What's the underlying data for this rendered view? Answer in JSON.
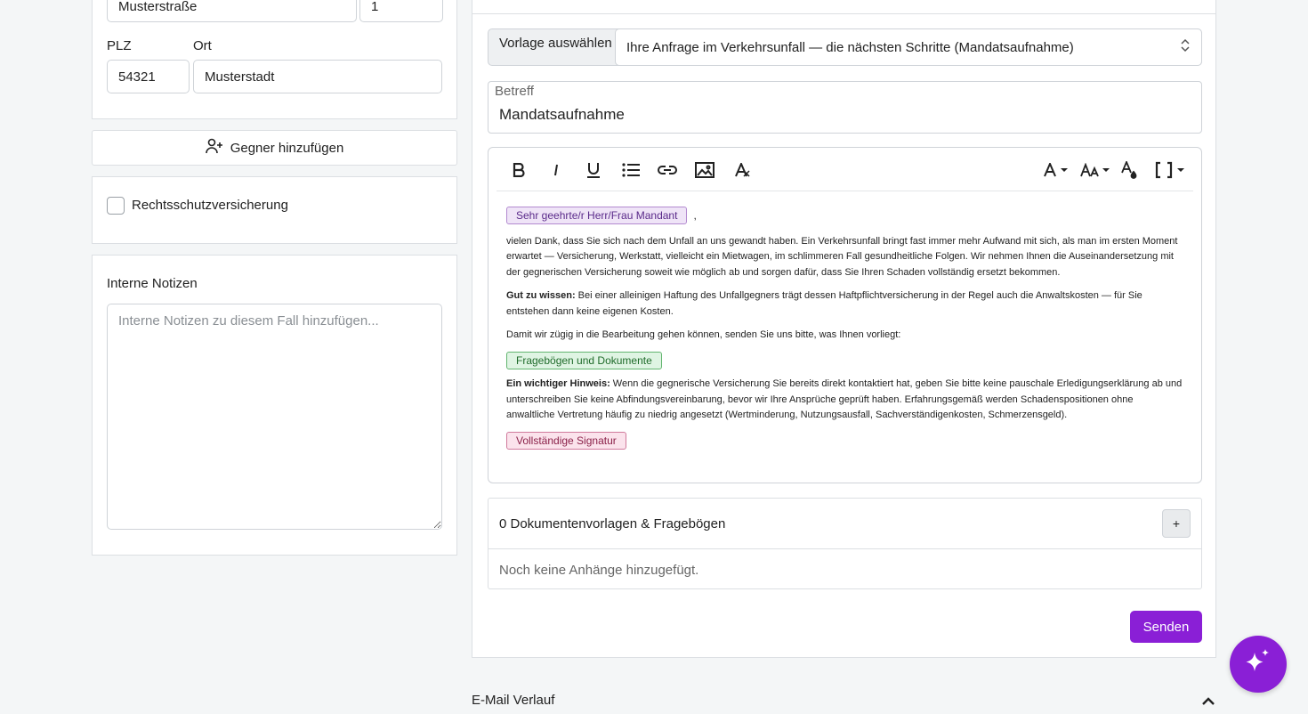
{
  "address": {
    "street_value": "Musterstraße",
    "number_value": "1",
    "plz_label": "PLZ",
    "plz_value": "54321",
    "city_label": "Ort",
    "city_value": "Musterstadt"
  },
  "add_opponent_label": "Gegner hinzufügen",
  "legal_insurance_label": "Rechtsschutzversicherung",
  "notes": {
    "title": "Interne Notizen",
    "placeholder": "Interne Notizen zu diesem Fall hinzufügen..."
  },
  "template": {
    "label": "Vorlage auswählen",
    "selected": "Ihre Anfrage im Verkehrsunfall — die nächsten Schritte (Mandatsaufnahme)"
  },
  "subject": {
    "label": "Betreff",
    "value": "Mandatsaufnahme"
  },
  "editor": {
    "toolbar": [
      "bold-icon",
      "italic-icon",
      "underline-icon",
      "list-icon",
      "link-icon",
      "image-icon",
      "clear-format-icon",
      "font-color-icon",
      "font-size-icon",
      "fill-icon",
      "code-view-icon"
    ],
    "greeting_tag": "Sehr geehrte/r Herr/Frau Mandant",
    "greeting_comma": ",",
    "para1": "vielen Dank, dass Sie sich nach dem Unfall an uns gewandt haben. Ein Verkehrsunfall bringt fast immer mehr Aufwand mit sich, als man im ersten Moment erwartet — Versicherung, Werkstatt, vielleicht ein Mietwagen, im schlimmeren Fall gesundheitliche Folgen. Wir nehmen Ihnen die Auseinandersetzung mit der gegnerischen Versicherung soweit wie möglich ab und sorgen dafür, dass Sie Ihren Schaden vollständig ersetzt bekommen.",
    "para2_bold": "Gut zu wissen:",
    "para2": " Bei einer alleinigen Haftung des Unfallgegners trägt dessen Haftpflichtversicherung in der Regel auch die Anwaltskosten — für Sie entstehen dann keine eigenen Kosten.",
    "para3": "Damit wir zügig in die Bearbeitung gehen können, senden Sie uns bitte, was Ihnen vorliegt:",
    "docs_tag": "Fragebögen und Dokumente",
    "para4_bold": "Ein wichtiger Hinweis:",
    "para4": " Wenn die gegnerische Versicherung Sie bereits direkt kontaktiert hat, geben Sie bitte keine pauschale Erledigungserklärung ab und unterschreiben Sie keine Abfindungsvereinbarung, bevor wir Ihre Ansprüche geprüft haben. Erfahrungsgemäß werden Schadenspositionen ohne anwaltliche Vertretung häufig zu niedrig angesetzt (Wertminderung, Nutzungsausfall, Sachverständigenkosten, Schmerzensgeld).",
    "signature_tag": "Vollständige Signatur"
  },
  "attachments": {
    "title": "0 Dokumentenvorlagen & Fragebögen",
    "add_label": "+",
    "empty": "Noch keine Anhänge hinzugefügt."
  },
  "send_label": "Senden",
  "history_label": "E-Mail Verlauf",
  "colors": {
    "accent": "#8a1fd6"
  }
}
